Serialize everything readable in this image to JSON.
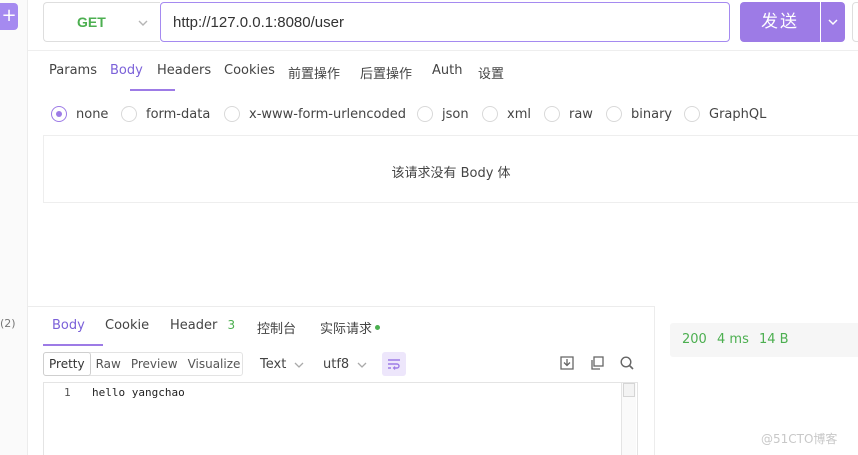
{
  "left": {
    "add_label": "+",
    "count": "(2)"
  },
  "request": {
    "method": "GET",
    "url": "http://127.0.0.1:8080/user",
    "send_label": "发送"
  },
  "request_tabs": [
    "Params",
    "Body",
    "Headers",
    "Cookies",
    "前置操作",
    "后置操作",
    "Auth",
    "设置"
  ],
  "active_request_tab": "Body",
  "body_types": [
    "none",
    "form-data",
    "x-www-form-urlencoded",
    "json",
    "xml",
    "raw",
    "binary",
    "GraphQL"
  ],
  "selected_body_type": "none",
  "empty_body_message": "该请求没有 Body 体",
  "response_tabs": {
    "body": "Body",
    "cookie": "Cookie",
    "header": "Header",
    "header_count": "3",
    "console": "控制台",
    "actual_request": "实际请求"
  },
  "format_buttons": [
    "Pretty",
    "Raw",
    "Preview",
    "Visualize"
  ],
  "active_format": "Pretty",
  "format_select": "Text",
  "encoding_select": "utf8",
  "code": {
    "line_number": "1",
    "text": "hello yangchao"
  },
  "status": {
    "code": "200",
    "time": "4 ms",
    "size": "14 B"
  },
  "watermark": "@51CTO博客",
  "colors": {
    "accent": "#9d7be6",
    "success": "#4caf50"
  }
}
